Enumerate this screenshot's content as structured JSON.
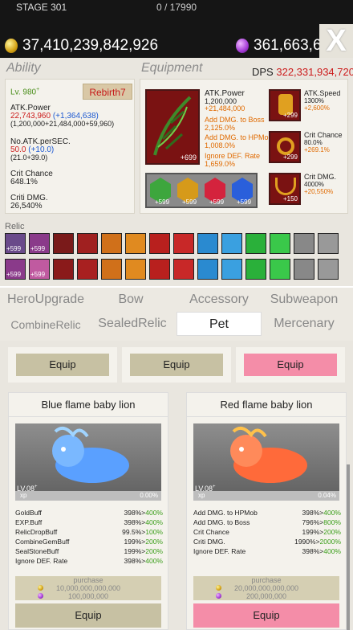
{
  "stage": {
    "label": "STAGE 301",
    "progress": "0 / 17990"
  },
  "currency": {
    "gold": "37,410,239,842,926",
    "purple": "361,663,69"
  },
  "close_label": "X",
  "ability": {
    "title": "Ability",
    "level": "Lv. 980",
    "level_sup": "+",
    "rebirth": "Rebirth7",
    "atk_label": "ATK.Power",
    "atk_value": "22,743,960",
    "atk_bonus": "(+1,364,638)",
    "atk_breakdown": "(1,200,000+21,484,000+59,960)",
    "noatk_label": "No.ATK.perSEC.",
    "noatk_value": "50.0",
    "noatk_bonus": "(+10.0)",
    "noatk_breakdown": "(21.0+39.0)",
    "crit_label": "Crit Chance",
    "crit_value": "648.1%",
    "critdmg_label": "Criti DMG.",
    "critdmg_value": "26,540%"
  },
  "equipment": {
    "title": "Equipment",
    "dps_label": "DPS",
    "dps_value": "322,331,934,720",
    "bow": {
      "plus": "+699",
      "atk_label": "ATK.Power",
      "atk_value": "1,200,000",
      "atk_bonus": "+21,484,000",
      "boss_label": "Add DMG. to Boss",
      "boss_value": "2,125.0%",
      "hp_label": "Add DMG. to HPMob",
      "hp_value": "1,008.0%",
      "ignore_label": "Ignore DEF. Rate",
      "ignore_value": "1,659.0%"
    },
    "gems": [
      "+599",
      "+599",
      "+599",
      "+599"
    ],
    "glove": {
      "plus": "+299",
      "label": "ATK.Speed",
      "value": "1300%",
      "bonus": "+2,600%"
    },
    "ring": {
      "plus": "+299",
      "label": "Crit Chance",
      "value": "80.0%",
      "bonus": "+269.1%"
    },
    "necklace": {
      "plus": "+150",
      "label": "Crit DMG.",
      "value": "4000%",
      "bonus": "+20,550%"
    }
  },
  "relic": {
    "title": "Relic",
    "badges": [
      "+599",
      "+599",
      "+599",
      "+599"
    ]
  },
  "tabs": {
    "hero": "HeroUpgrade",
    "bow": "Bow",
    "accessory": "Accessory",
    "subweapon": "Subweapon",
    "combine": "CombineRelic",
    "sealed": "SealedRelic",
    "pet": "Pet",
    "mercenary": "Mercenary"
  },
  "equip_row": [
    "Equip",
    "Equip",
    "Equip"
  ],
  "pets": [
    {
      "name": "Blue flame baby lion",
      "level": "LV.08",
      "level_sup": "+",
      "xp": "xp",
      "xp_pct": "0.00%",
      "buffs": [
        {
          "label": "GoldBuff",
          "v1": "398%",
          "v2": "400%"
        },
        {
          "label": "EXP.Buff",
          "v1": "398%",
          "v2": "400%"
        },
        {
          "label": "RelicDropBuff",
          "v1": "99.5%",
          "v2": "100%"
        },
        {
          "label": "CombineGemBuff",
          "v1": "199%",
          "v2": "200%"
        },
        {
          "label": "SealStoneBuff",
          "v1": "199%",
          "v2": "200%"
        },
        {
          "label": "Ignore DEF. Rate",
          "v1": "398%",
          "v2": "400%"
        }
      ],
      "purchase": "purchase",
      "gold_cost": "10,000,000,000,000",
      "purple_cost": "100,000,000",
      "equip": "Equip"
    },
    {
      "name": "Red flame baby lion",
      "level": "LV.08",
      "level_sup": "+",
      "xp": "xp",
      "xp_pct": "0.04%",
      "buffs": [
        {
          "label": "Add DMG. to HPMob",
          "v1": "398%",
          "v2": "400%"
        },
        {
          "label": "Add DMG. to Boss",
          "v1": "796%",
          "v2": "800%"
        },
        {
          "label": "Crit Chance",
          "v1": "199%",
          "v2": "200%"
        },
        {
          "label": "Criti DMG.",
          "v1": "1990%",
          "v2": "2000%"
        },
        {
          "label": "Ignore DEF. Rate",
          "v1": "398%",
          "v2": "400%"
        }
      ],
      "purchase": "purchase",
      "gold_cost": "20,000,000,000,000",
      "purple_cost": "200,000,000",
      "equip": "Equip"
    }
  ],
  "colors": {
    "accent_pink": "#f48da8",
    "tan": "#c7c1a3",
    "orange": "#e06a00",
    "blue": "#1d59d1",
    "red": "#cc1c1c"
  }
}
